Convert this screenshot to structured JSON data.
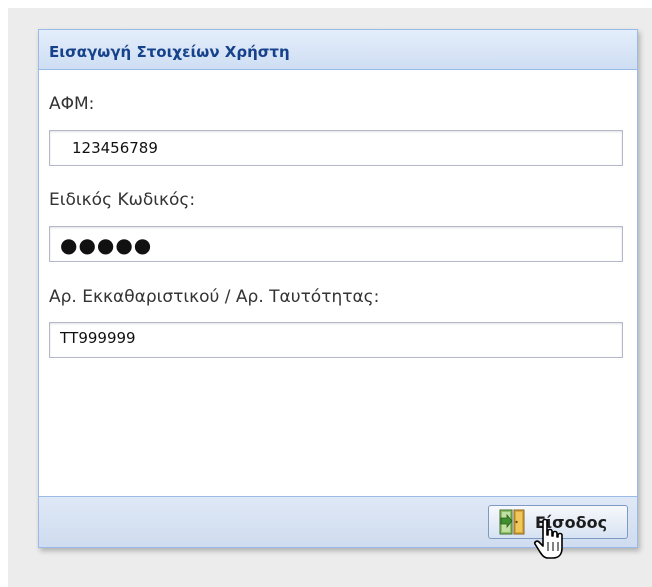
{
  "panel": {
    "title": "Εισαγωγή Στοιχείων Χρήστη"
  },
  "form": {
    "afm": {
      "label": "ΑΦΜ:",
      "value": "123456789"
    },
    "code": {
      "label": "Ειδικός Κωδικός:",
      "value": "●●●●●"
    },
    "id": {
      "label": "Αρ. Εκκαθαριστικού / Αρ. Ταυτότητας:",
      "value": "ΤΤ999999"
    }
  },
  "footer": {
    "submit_label": "Είσοδος",
    "submit_icon": "login-door-icon"
  },
  "colors": {
    "header_text": "#15428b",
    "panel_border": "#99bbe8",
    "icon_green": "#3f8f2f"
  }
}
